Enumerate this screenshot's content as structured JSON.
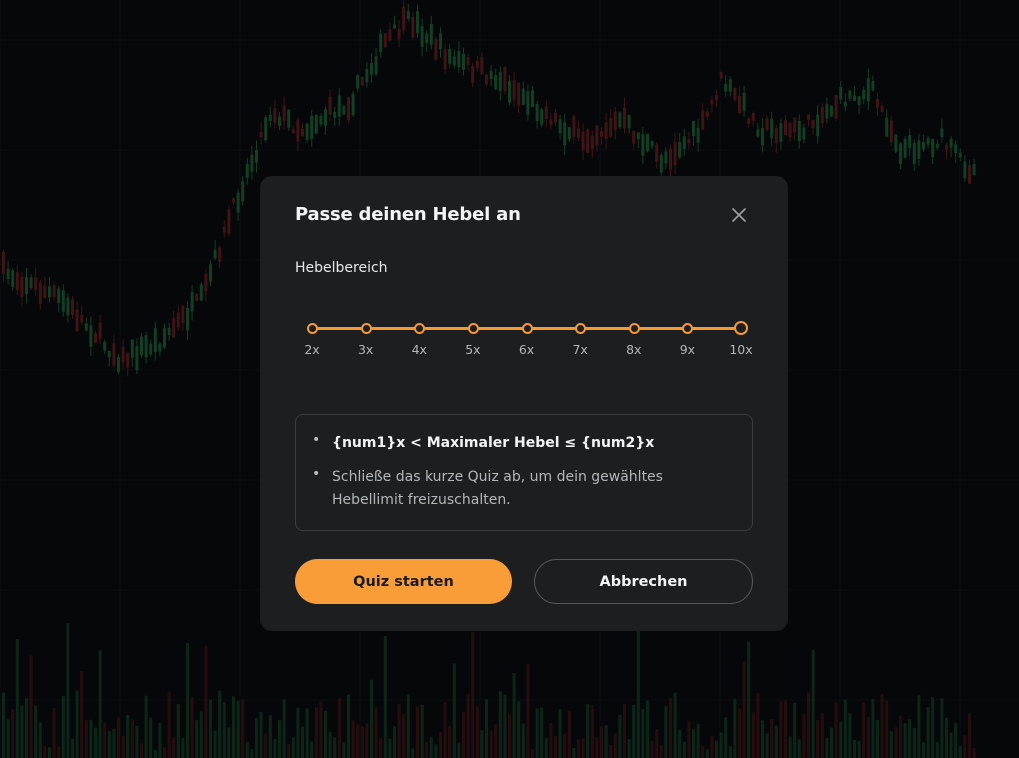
{
  "modal": {
    "title": "Passe deinen Hebel an",
    "close_icon": "close-icon",
    "section_label": "Hebelbereich",
    "slider": {
      "options": [
        "2x",
        "3x",
        "4x",
        "5x",
        "6x",
        "7x",
        "8x",
        "9x",
        "10x"
      ],
      "selected": "10x"
    },
    "info": {
      "line1": "{num1}x < Maximaler Hebel ≤ {num2}x",
      "line2": "Schließe das kurze Quiz ab, um dein gewähltes Hebellimit freizuschalten."
    },
    "buttons": {
      "primary": "Quiz starten",
      "secondary": "Abbrechen"
    }
  },
  "colors": {
    "accent": "#f89d38",
    "candle_up": "#1f6b43",
    "candle_down": "#6e2227"
  }
}
